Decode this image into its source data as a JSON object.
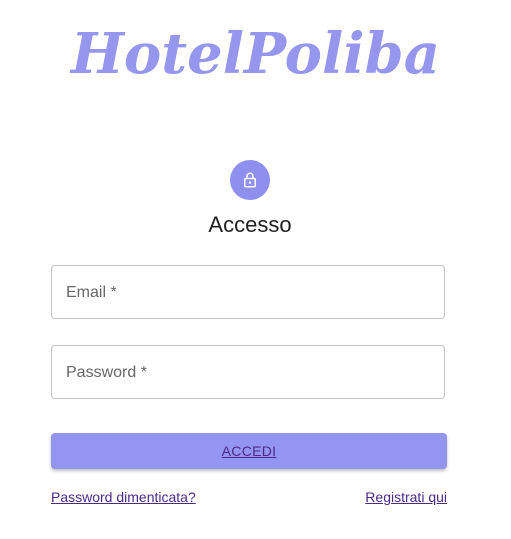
{
  "brand": {
    "logo_text": "HotelPoliba",
    "accent_color": "#9696ee"
  },
  "login": {
    "icon": "lock-icon",
    "title": "Accesso",
    "email": {
      "label": "Email *",
      "value": ""
    },
    "password": {
      "label": "Password *",
      "value": ""
    },
    "submit_label": "ACCEDI",
    "forgot_password_link": "Password dimenticata?",
    "register_link": "Registrati qui"
  }
}
